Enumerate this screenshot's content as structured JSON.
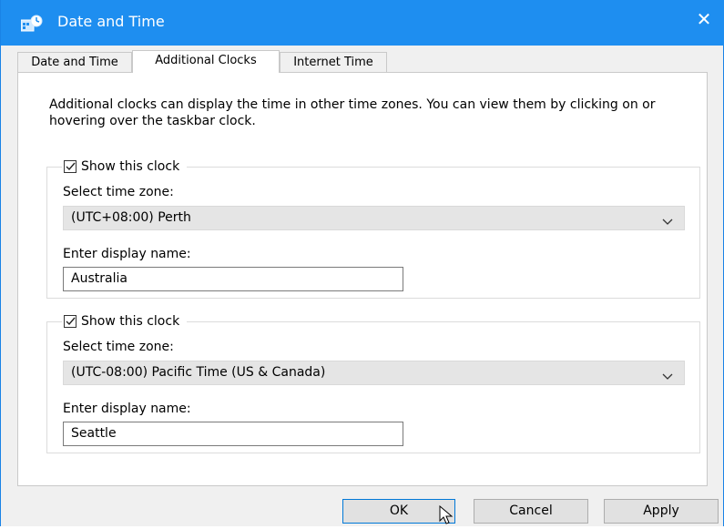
{
  "window": {
    "title": "Date and Time",
    "close_glyph": "✕",
    "titlebar_color": "#1e8ef0"
  },
  "tabs": [
    {
      "label": "Date and Time",
      "active": false
    },
    {
      "label": "Additional Clocks",
      "active": true
    },
    {
      "label": "Internet Time",
      "active": false
    }
  ],
  "description": "Additional clocks can display the time in other time zones. You can view them by clicking on or hovering over the taskbar clock.",
  "clocks": [
    {
      "show_label": "Show this clock",
      "checked": true,
      "timezone_label": "Select time zone:",
      "timezone_value": "(UTC+08:00) Perth",
      "name_label": "Enter display name:",
      "name_value": "Australia"
    },
    {
      "show_label": "Show this clock",
      "checked": true,
      "timezone_label": "Select time zone:",
      "timezone_value": "(UTC-08:00) Pacific Time (US & Canada)",
      "name_label": "Enter display name:",
      "name_value": "Seattle"
    }
  ],
  "buttons": {
    "ok": "OK",
    "cancel": "Cancel",
    "apply": "Apply"
  },
  "icons": {
    "app": "date-time-control-panel-icon",
    "close": "close-icon",
    "checkbox": "checkmark-icon",
    "dropdown": "chevron-down-icon",
    "cursor": "mouse-pointer-icon"
  }
}
